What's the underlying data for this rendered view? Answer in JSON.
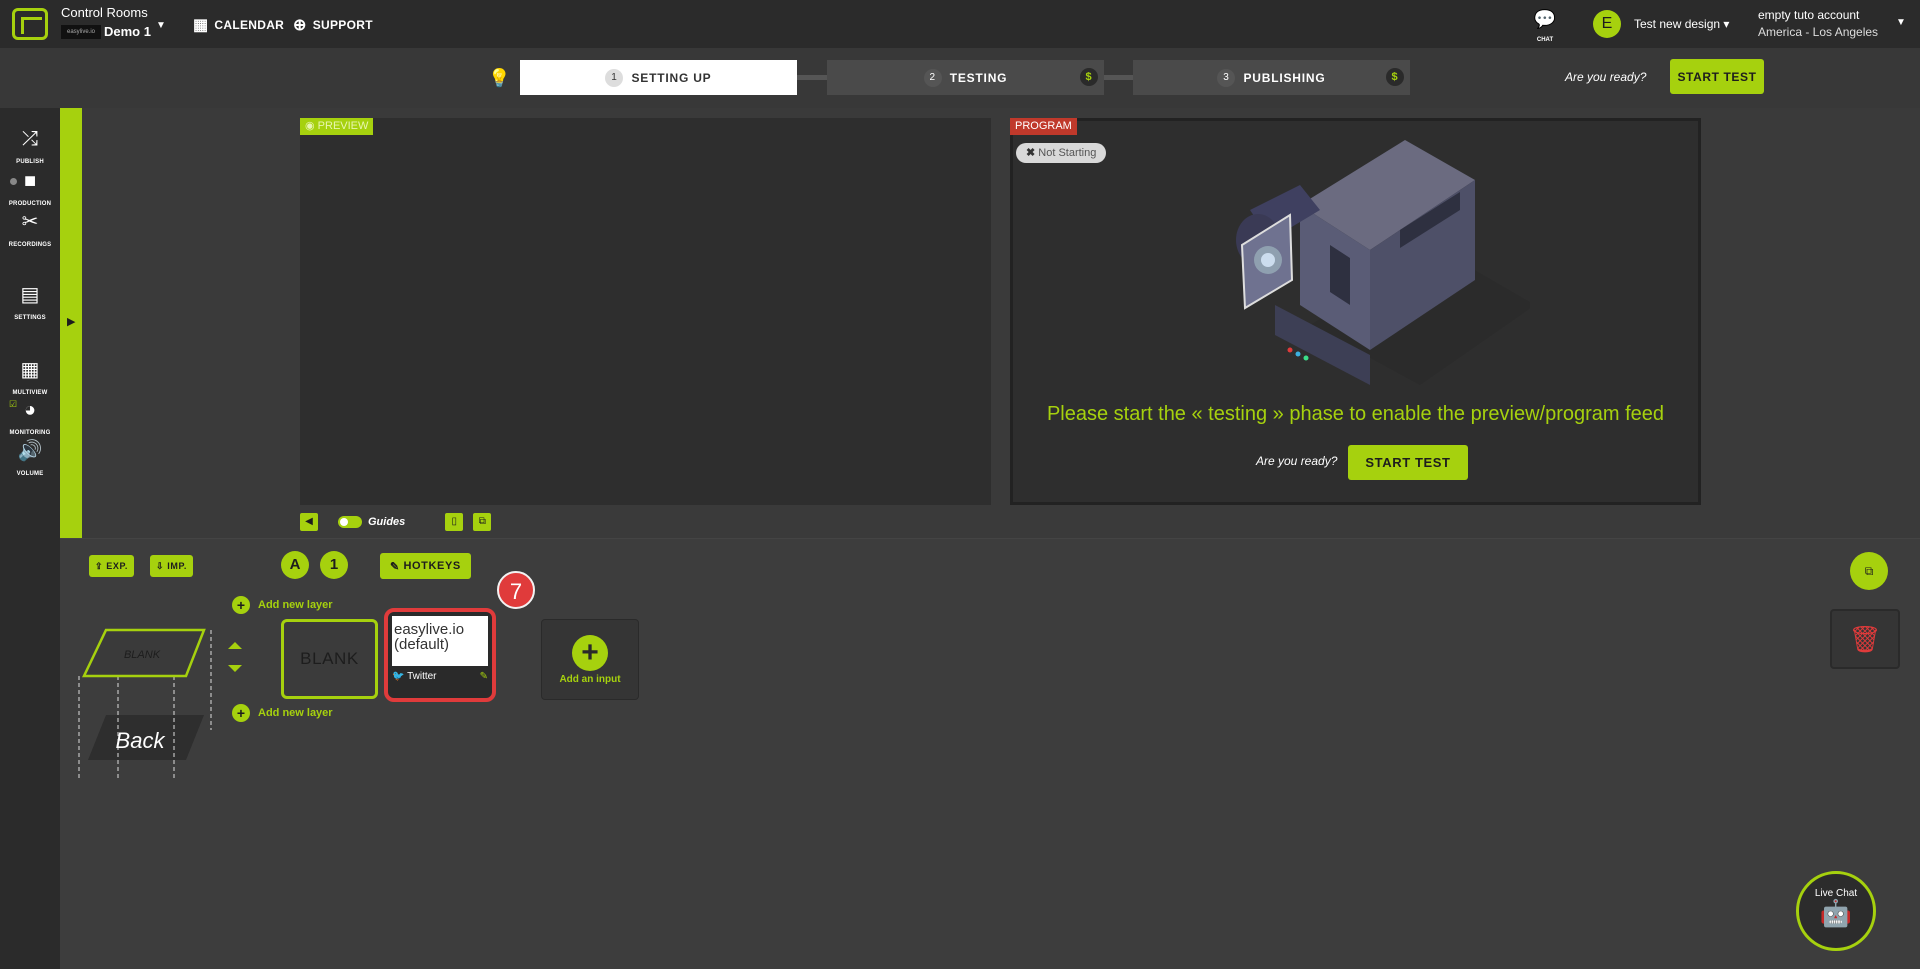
{
  "header": {
    "room_title": "Control Rooms",
    "room_logo_text": "easylive.io",
    "room_name": "Demo 1",
    "calendar_label": "CALENDAR",
    "support_label": "SUPPORT",
    "chat_label": "CHAT",
    "avatar_letter": "E",
    "design_name": "Test new design",
    "account_name": "empty tuto account",
    "account_timezone": "America - Los Angeles"
  },
  "steps": [
    {
      "num": "1",
      "label": "SETTING UP"
    },
    {
      "num": "2",
      "label": "TESTING",
      "paid": "$"
    },
    {
      "num": "3",
      "label": "PUBLISHING",
      "paid": "$"
    }
  ],
  "ready_prompt": "Are you ready?",
  "start_test_label": "START TEST",
  "sidebar": [
    {
      "label": "PUBLISH",
      "icon": "shuffle-icon"
    },
    {
      "label": "PRODUCTION",
      "icon": "video-camera-icon"
    },
    {
      "label": "RECORDINGS",
      "icon": "scissors-icon"
    },
    {
      "label": "SETTINGS",
      "icon": "newspaper-icon"
    },
    {
      "label": "MULTIVIEW",
      "icon": "grid-icon"
    },
    {
      "label": "MONITORING",
      "icon": "palette-icon"
    },
    {
      "label": "VOLUME",
      "icon": "speaker-icon"
    }
  ],
  "preview": {
    "badge": "PREVIEW",
    "guides_label": "Guides"
  },
  "program": {
    "badge": "PROGRAM",
    "status": "Not Starting",
    "message": "Please start the « testing » phase to enable the preview/program feed",
    "ready_prompt": "Are you ready?",
    "start_label": "START TEST"
  },
  "lower": {
    "export_label": "EXP.",
    "import_label": "IMP.",
    "scene_letter": "A",
    "scene_number": "1",
    "hotkeys_label": "HOTKEYS",
    "add_layer_label": "Add new layer",
    "blank_label": "BLANK",
    "diagram_front": "BLANK",
    "diagram_back": "Back",
    "input_card": {
      "title": "easylive.io (default)",
      "source": "Twitter"
    },
    "step_badge": "7",
    "add_input_label": "Add an input"
  },
  "livechat_label": "Live Chat",
  "colors": {
    "accent": "#a6d10e",
    "danger": "#e03b3b",
    "program_badge": "#c0392b"
  }
}
